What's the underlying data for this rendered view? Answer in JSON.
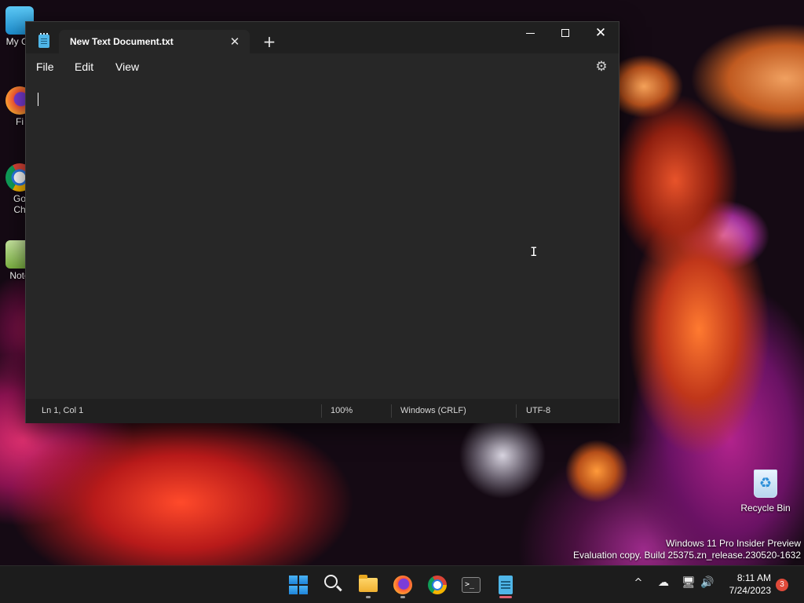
{
  "desktop": {
    "icons": [
      {
        "label": "My Co",
        "icon": "computer-icon",
        "color": "#3aa9e0"
      },
      {
        "label": "Fi",
        "icon": "firefox-icon",
        "color": "#ff7139"
      },
      {
        "label": "Go",
        "label2": "Ch",
        "icon": "chrome-icon",
        "color": "#2b78e4"
      },
      {
        "label": "Note",
        "icon": "notepad-icon",
        "color": "#7cb342"
      }
    ],
    "recycle_bin_label": "Recycle Bin",
    "watermark_line1": "Windows 11 Pro Insider Preview",
    "watermark_line2": "Evaluation copy. Build 25375.zn_release.230520-1632"
  },
  "window": {
    "tab_title": "New Text Document.txt",
    "tab_close_glyph": "✕",
    "new_tab_glyph": "+",
    "minimize_label": "",
    "close_glyph": "✕",
    "menu": {
      "file": "File",
      "edit": "Edit",
      "view": "View"
    },
    "settings_glyph": "⚙",
    "editor_text": ""
  },
  "statusbar": {
    "position": "Ln 1, Col 1",
    "zoom": "100%",
    "line_ending": "Windows (CRLF)",
    "encoding": "UTF-8"
  },
  "taskbar": {
    "apps": [
      {
        "name": "start",
        "icon": "windows-start-icon"
      },
      {
        "name": "search",
        "icon": "search-icon"
      },
      {
        "name": "file-explorer",
        "icon": "folder-icon"
      },
      {
        "name": "firefox",
        "icon": "firefox-icon"
      },
      {
        "name": "chrome",
        "icon": "chrome-icon"
      },
      {
        "name": "terminal",
        "icon": "terminal-icon",
        "glyph": ">_"
      },
      {
        "name": "notepad",
        "icon": "notepad-icon"
      }
    ],
    "tray": {
      "chevron_glyph": "^",
      "cloud_glyph": "☁",
      "network_glyph": "🖥",
      "volume_glyph": "🔊"
    },
    "time": "8:11 AM",
    "date": "7/24/2023",
    "notification_count": "3"
  },
  "colors": {
    "window_bg": "#272727",
    "titlebar_bg": "#202020",
    "taskbar_bg": "#1c1c1c",
    "accent_notepad": "#4fb6e8",
    "badge": "#e04a3a"
  }
}
